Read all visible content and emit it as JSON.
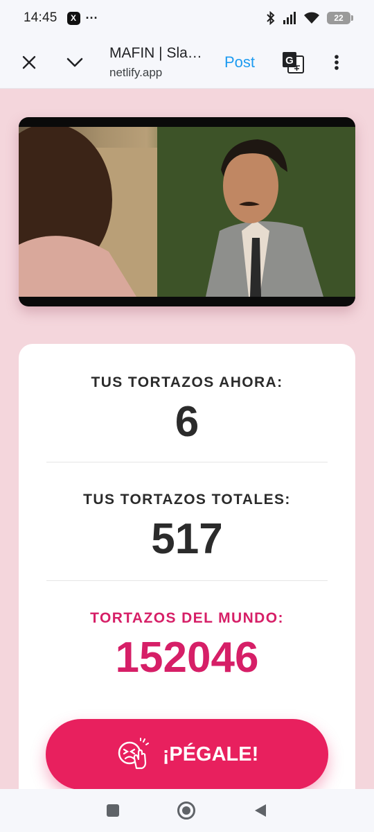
{
  "status_bar": {
    "time": "14:45",
    "app_badge": "X",
    "more": "···",
    "battery": "22"
  },
  "browser": {
    "title": "MAFIN | Sla…",
    "url": "netlify.app",
    "post_label": "Post"
  },
  "stats": {
    "now_label": "TUS TORTAZOS AHORA:",
    "now_value": "6",
    "total_label": "TUS TORTAZOS TOTALES:",
    "total_value": "517",
    "world_label": "TORTAZOS DEL MUNDO:",
    "world_value": "152046"
  },
  "hit_button": {
    "label": "¡PÉGALE!"
  },
  "colors": {
    "background": "#f4d6dc",
    "accent": "#e8205e",
    "world_text": "#d61f67",
    "post_blue": "#1d9bf0"
  },
  "icons": [
    "close-icon",
    "chevron-down-icon",
    "translate-icon",
    "overflow-menu-icon",
    "slap-face-icon",
    "bluetooth-icon",
    "signal-icon",
    "wifi-icon",
    "battery-icon",
    "recents-icon",
    "home-icon",
    "back-icon"
  ]
}
